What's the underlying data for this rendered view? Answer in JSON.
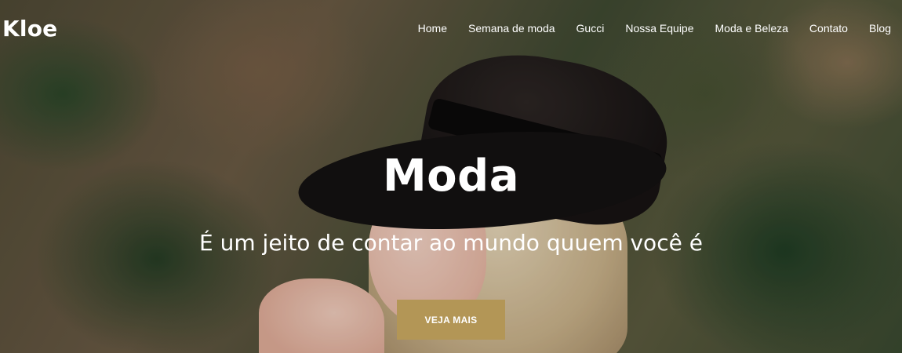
{
  "brand": {
    "name": "Kloe"
  },
  "nav": {
    "items": [
      {
        "label": "Home"
      },
      {
        "label": "Semana de moda"
      },
      {
        "label": "Gucci"
      },
      {
        "label": "Nossa Equipe"
      },
      {
        "label": "Moda e Beleza"
      },
      {
        "label": "Contato"
      },
      {
        "label": "Blog"
      }
    ]
  },
  "hero": {
    "title": "Moda",
    "subtitle": "É um jeito de contar ao mundo quuem você é",
    "cta_label": "VEJA MAIS",
    "accent_color": "#b39656"
  }
}
